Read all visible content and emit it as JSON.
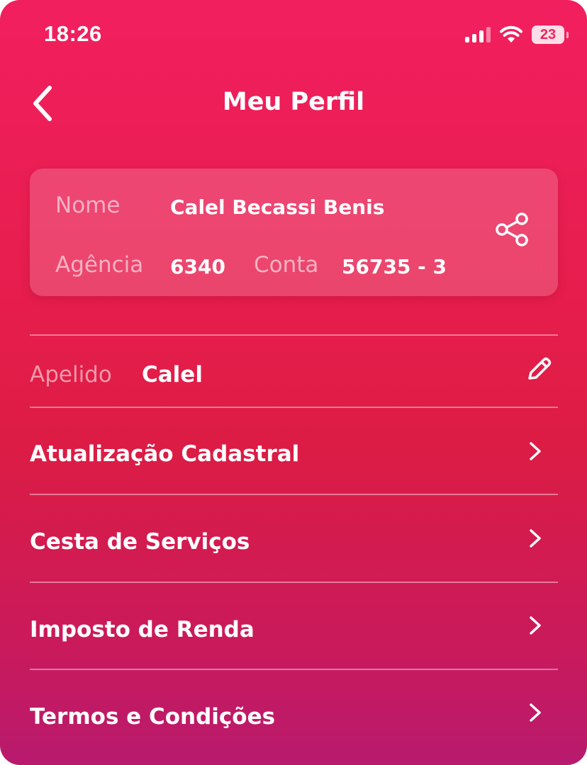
{
  "status_bar": {
    "time": "18:26",
    "battery": "23"
  },
  "header": {
    "title": "Meu Perfil"
  },
  "profile_card": {
    "name_label": "Nome",
    "name_value": "Calel Becassi Benis",
    "agency_label": "Agência",
    "agency_value": "6340",
    "account_label": "Conta",
    "account_value": "56735 - 3"
  },
  "nickname": {
    "label": "Apelido",
    "value": "Calel"
  },
  "menu": {
    "items": [
      {
        "label": "Atualização Cadastral"
      },
      {
        "label": "Cesta de Serviços"
      },
      {
        "label": "Imposto de Renda"
      },
      {
        "label": "Termos e Condições"
      }
    ]
  },
  "colors": {
    "gradient_top": "#f21f5f",
    "gradient_mid": "#dc1c44",
    "gradient_bottom": "#b81a6e",
    "text": "#ffffff"
  }
}
